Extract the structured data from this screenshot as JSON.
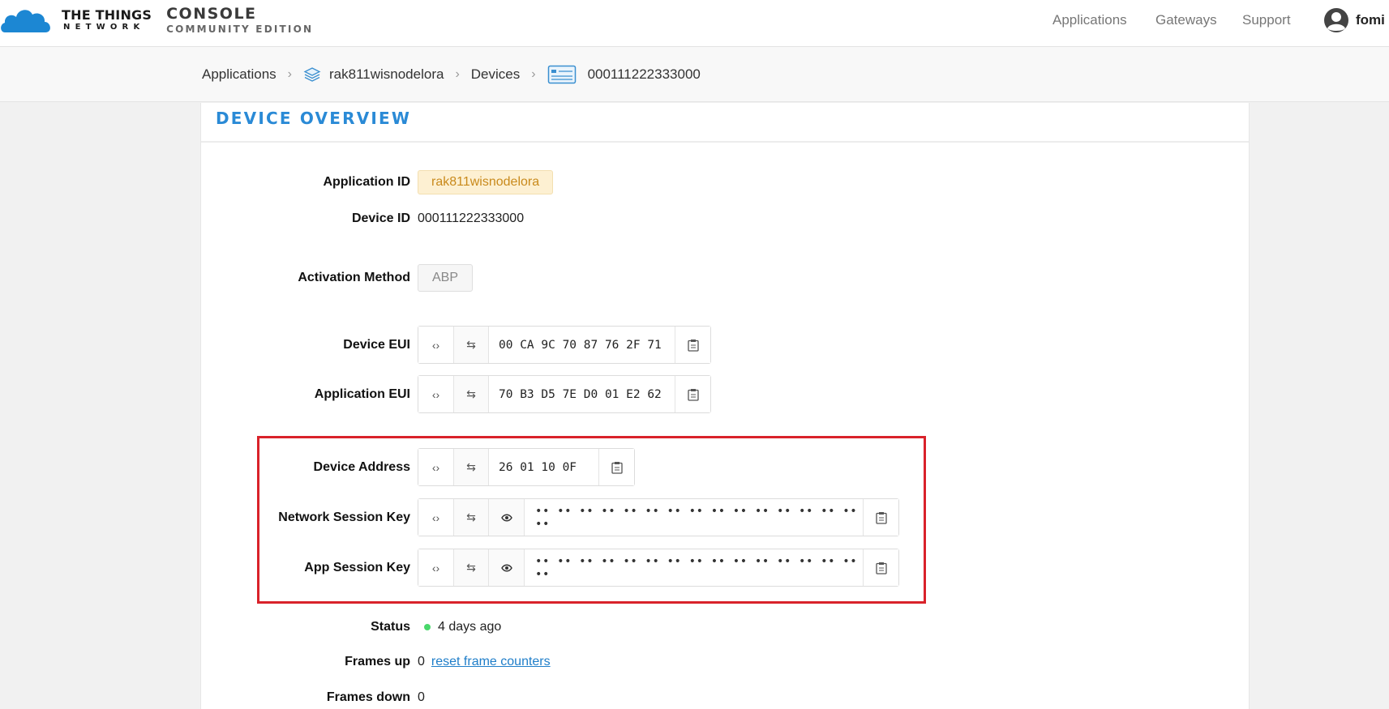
{
  "brand": {
    "line1": "THE THINGS",
    "line2": "NETWORK",
    "console_line1": "CONSOLE",
    "console_line2": "COMMUNITY EDITION"
  },
  "nav": {
    "applications": "Applications",
    "gateways": "Gateways",
    "support": "Support",
    "user": "fomi"
  },
  "breadcrumb": {
    "applications": "Applications",
    "app": "rak811wisnodelora",
    "devices": "Devices",
    "device": "000111222333000"
  },
  "card": {
    "title": "DEVICE OVERVIEW"
  },
  "fields": {
    "app_id_label": "Application ID",
    "app_id": "rak811wisnodelora",
    "device_id_label": "Device ID",
    "device_id": "000111222333000",
    "activation_label": "Activation Method",
    "activation": "ABP",
    "dev_eui_label": "Device EUI",
    "dev_eui": "00 CA 9C 70 87 76 2F 71",
    "app_eui_label": "Application EUI",
    "app_eui": "70 B3 D5 7E D0 01 E2 62",
    "dev_addr_label": "Device Address",
    "dev_addr": "26 01 10 0F",
    "nwk_key_label": "Network Session Key",
    "nwk_key": "•• •• •• •• •• •• •• •• •• •• •• •• •• •• •• ••",
    "app_key_label": "App Session Key",
    "app_key": "•• •• •• •• •• •• •• •• •• •• •• •• •• •• •• ••",
    "status_label": "Status",
    "status": "4 days ago",
    "frames_up_label": "Frames up",
    "frames_up": "0",
    "reset_link": "reset frame counters",
    "frames_down_label": "Frames down",
    "frames_down": "0"
  },
  "icons": {
    "toggle_format": "‹›",
    "swap": "⇆",
    "eye": "eye-icon",
    "copy": "clipboard-icon"
  },
  "colors": {
    "accent": "#2a8ad6",
    "highlight": "#d9222a",
    "status_online": "#49d86b",
    "app_badge_bg": "#fdf0d2"
  }
}
